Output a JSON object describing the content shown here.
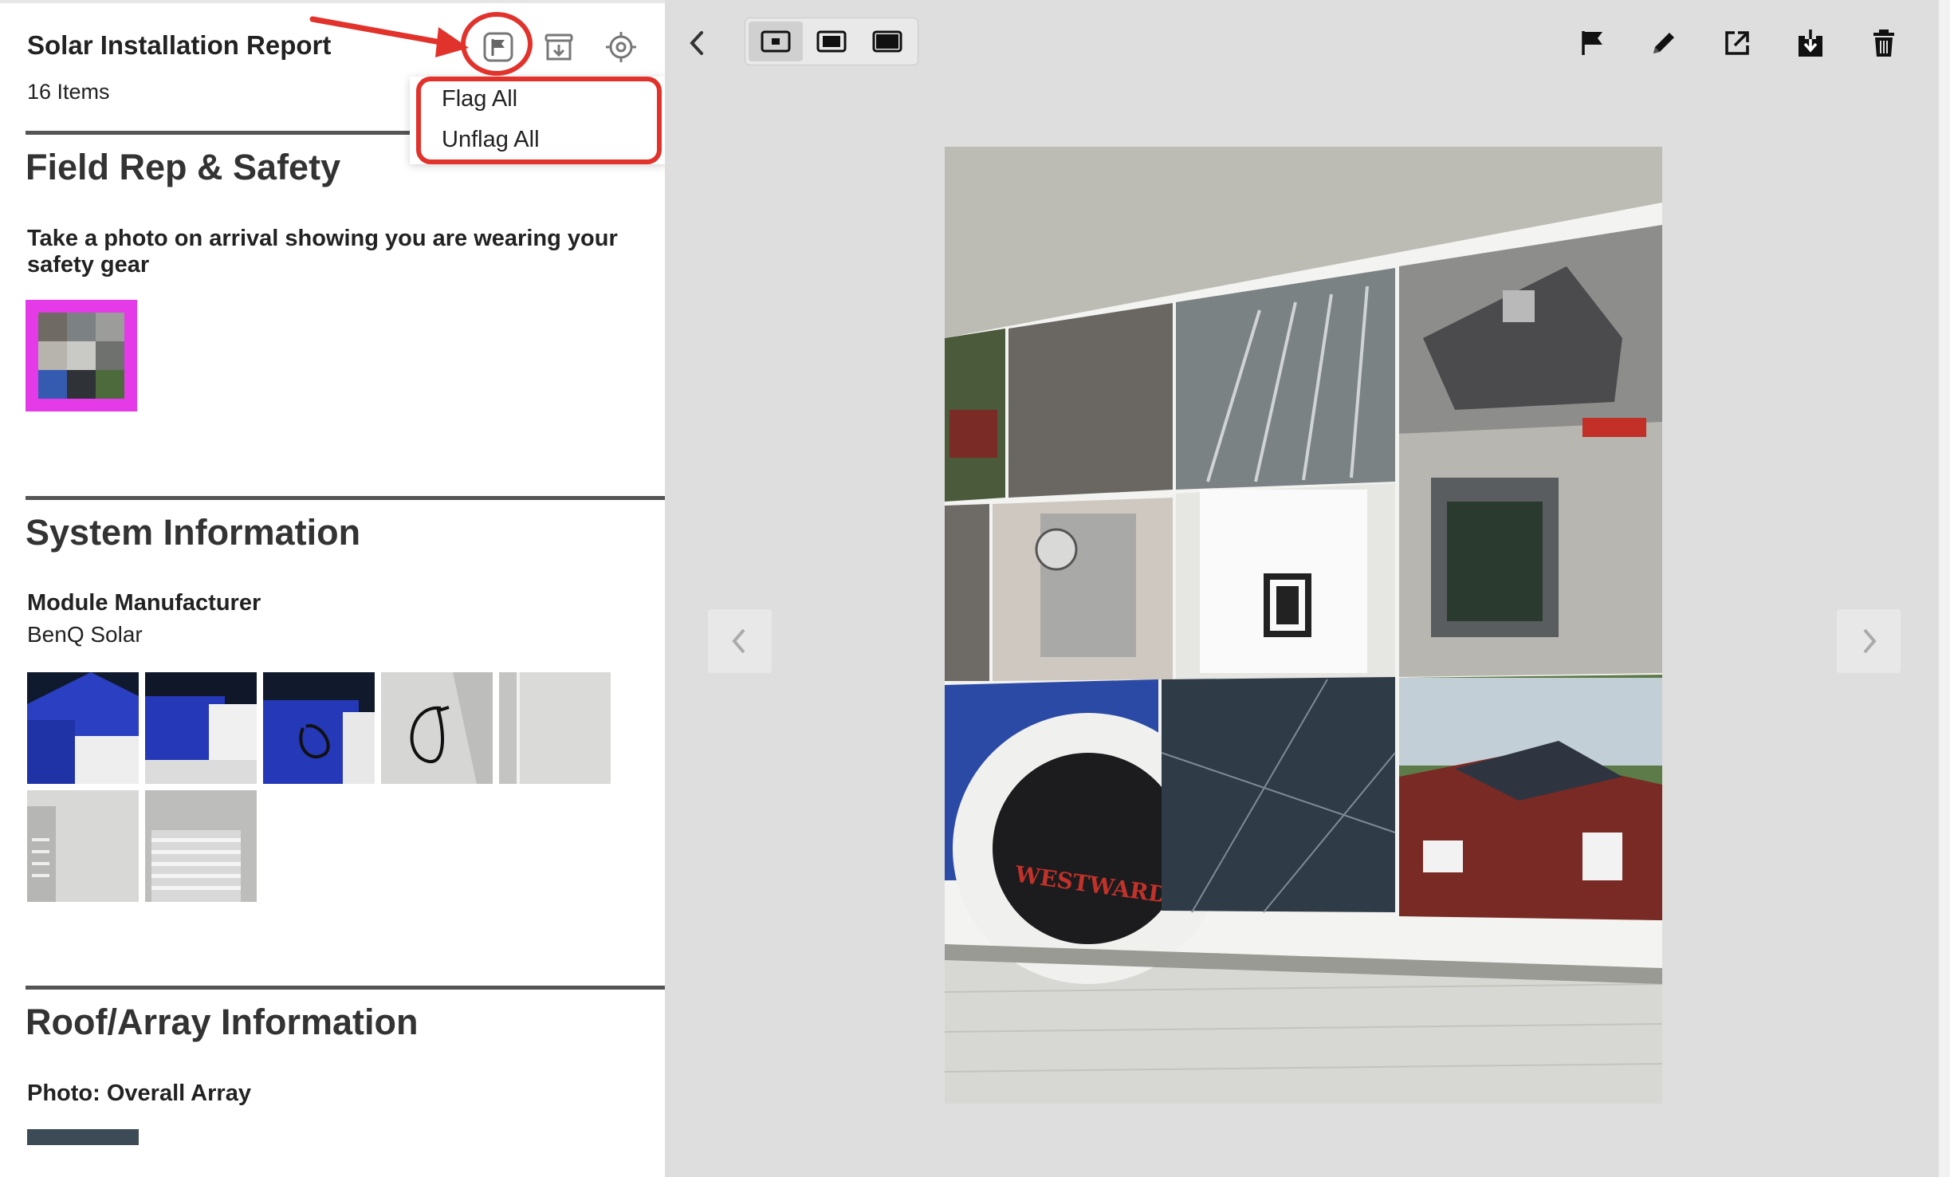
{
  "report": {
    "title": "Solar Installation Report",
    "item_count": "16 Items"
  },
  "header_icons": [
    "flag-icon",
    "archive-download-icon",
    "target-icon"
  ],
  "dropdown": {
    "items": [
      "Flag All",
      "Unflag All"
    ]
  },
  "sections": [
    {
      "title": "Field Rep & Safety",
      "question": "Take a photo on arrival showing you are wearing your safety gear",
      "photo_count": 1
    },
    {
      "title": "System Information",
      "question": "Module Manufacturer",
      "answer": "BenQ Solar",
      "photo_count": 7
    },
    {
      "title": "Roof/Array Information",
      "question": "Photo: Overall Array"
    }
  ],
  "toolbar": {
    "back": "back-chevron-icon",
    "view_sizes": [
      "small-view-icon",
      "medium-view-icon",
      "large-view-icon"
    ],
    "actions": [
      "flag-icon",
      "pencil-icon",
      "external-link-icon",
      "download-icon",
      "trash-icon"
    ]
  },
  "photo_text": {
    "scale_brand": "WESTWARD"
  },
  "colors": {
    "annotation_red": "#e2322c",
    "selected_thumb_border": "#e43ae8",
    "viewer_bg": "#dedede"
  }
}
